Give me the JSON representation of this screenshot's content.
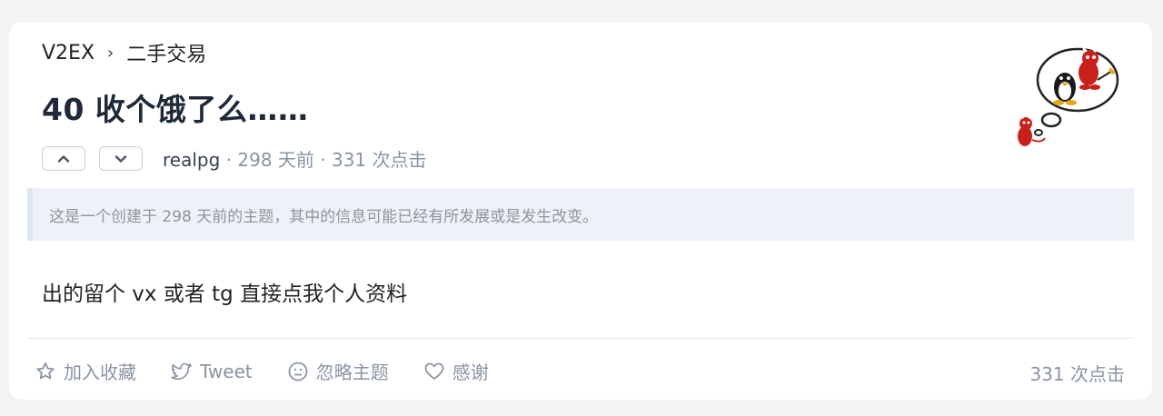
{
  "breadcrumb": {
    "site": "V2EX",
    "separator": "›",
    "node": "二手交易"
  },
  "topic": {
    "title": "40 收个饿了么……",
    "author": "realpg",
    "meta_rest": " · 298 天前 · 331 次点击",
    "content": "出的留个 vx 或者 tg 直接点我个人资料"
  },
  "notice": "这是一个创建于 298 天前的主题，其中的信息可能已经有所发展或是发生改变。",
  "actions": {
    "favorite": "加入收藏",
    "tweet": "Tweet",
    "ignore": "忽略主题",
    "thanks": "感谢"
  },
  "views": "331 次点击",
  "icons": {
    "upvote": "chevron-up-icon",
    "downvote": "chevron-down-icon",
    "favorite": "star-icon",
    "tweet": "twitter-bird-icon",
    "ignore": "neutral-face-icon",
    "thanks": "heart-icon",
    "avatar": "bsd-daemon-tux-avatar"
  },
  "colors": {
    "background": "#f2f3f5",
    "card": "#ffffff",
    "muted_text": "#8a94a3",
    "notice_bg": "#eef2f8",
    "title": "#1f2937"
  }
}
